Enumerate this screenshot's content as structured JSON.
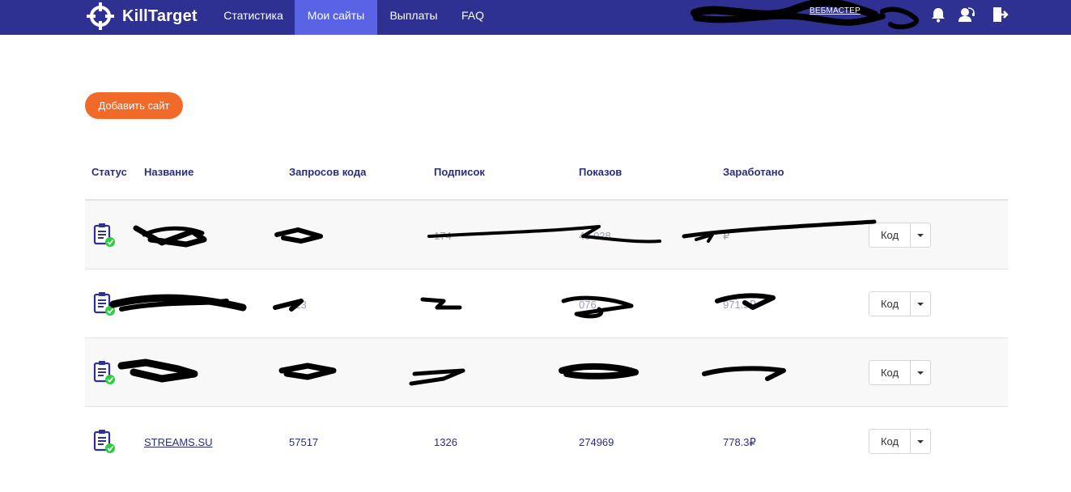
{
  "app": {
    "name": "KillTarget"
  },
  "nav": {
    "items": [
      {
        "label": "Статистика",
        "active": false
      },
      {
        "label": "Мои сайты",
        "active": true
      },
      {
        "label": "Выплаты",
        "active": false
      },
      {
        "label": "FAQ",
        "active": false
      }
    ],
    "role_label": "ВЕБМАСТЕР",
    "icons": [
      "bell-icon",
      "support-icon",
      "logout-icon"
    ]
  },
  "actions": {
    "add_site_label": "Добавить сайт"
  },
  "table": {
    "headers": {
      "status": "Статус",
      "name": "Название",
      "requests": "Запросов кода",
      "subscriptions": "Подписок",
      "views": "Показов",
      "earned": "Заработано"
    },
    "code_button_label": "Код",
    "rows": [
      {
        "name": "",
        "requests": "",
        "subscriptions": "174",
        "views": "40 028",
        "earned": "₽",
        "status_icon": "clipboard-check-icon"
      },
      {
        "name": "",
        "requests": "223",
        "subscriptions": "",
        "views": "076",
        "earned": "971.9₽",
        "status_icon": "clipboard-check-icon"
      },
      {
        "name": "",
        "requests": "",
        "subscriptions": "",
        "views": "",
        "earned": "",
        "status_icon": "clipboard-check-icon"
      },
      {
        "name": "STREAMS.SU",
        "requests": "57517",
        "subscriptions": "1326",
        "views": "274969",
        "earned": "778.3₽",
        "status_icon": "clipboard-check-icon"
      }
    ]
  },
  "colors": {
    "navbar": "#2e3192",
    "nav_active": "#5a62e6",
    "accent_button": "#f26a2a",
    "text": "#2b2d7a",
    "status_ok": "#2ecc40"
  }
}
